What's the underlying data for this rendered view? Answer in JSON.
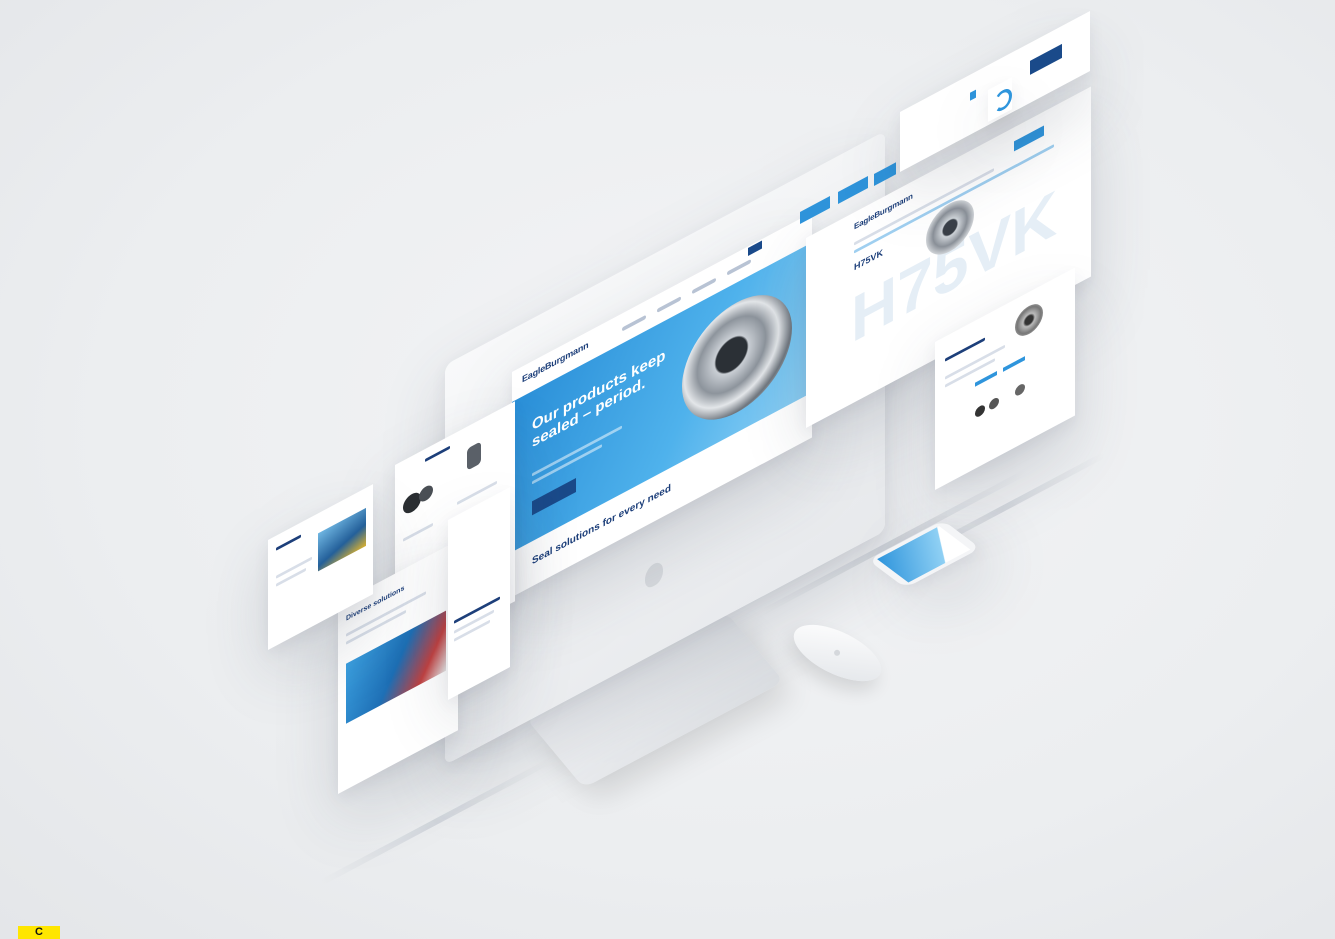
{
  "hero": {
    "brand": "EagleBurgmann",
    "headline_line1": "Our products keep",
    "headline_line2": "sealed – period.",
    "section_title": "Seal solutions for every need"
  },
  "product_page": {
    "brand": "EagleBurgmann",
    "product_code": "H75VK",
    "watermark": "H75VK"
  },
  "left_page": {
    "title": "Diverse solutions"
  },
  "tag": {
    "label": "C"
  },
  "colors": {
    "brand_blue": "#2f95dc",
    "dark_blue": "#1a4a8a",
    "background": "#ebedef"
  }
}
